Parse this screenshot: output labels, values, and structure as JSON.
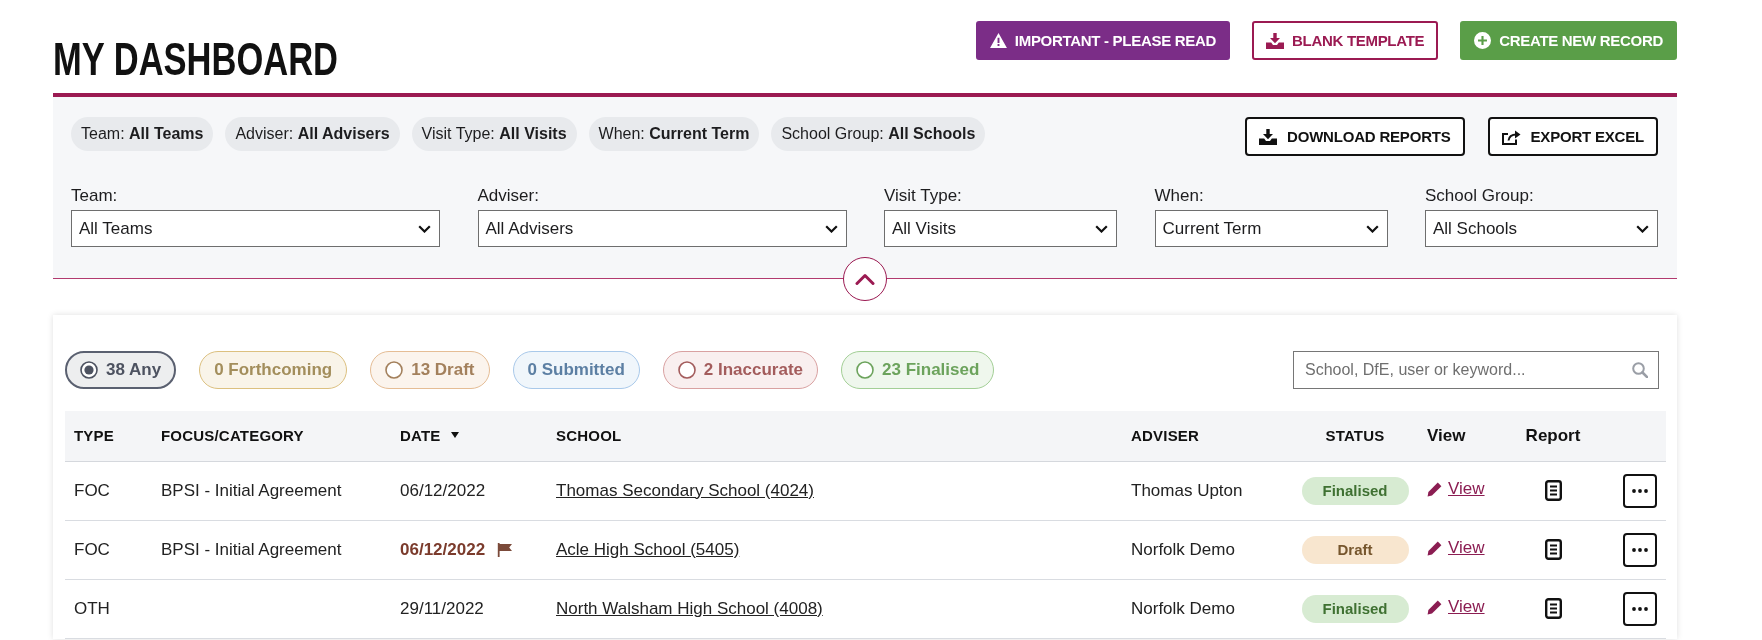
{
  "page": {
    "title": "MY DASHBOARD"
  },
  "header_buttons": [
    {
      "kind": "warning",
      "label": "IMPORTANT - PLEASE READ"
    },
    {
      "kind": "download",
      "label": "BLANK TEMPLATE"
    },
    {
      "kind": "create",
      "label": "CREATE NEW RECORD"
    }
  ],
  "filters": {
    "expanded": true,
    "chips": [
      {
        "label": "Team:",
        "value": "All Teams"
      },
      {
        "label": "Adviser:",
        "value": "All Advisers"
      },
      {
        "label": "Visit Type:",
        "value": "All Visits"
      },
      {
        "label": "When:",
        "value": "Current Term"
      },
      {
        "label": "School Group:",
        "value": "All Schools"
      }
    ],
    "actions": [
      {
        "kind": "download",
        "label": "DOWNLOAD REPORTS"
      },
      {
        "kind": "export",
        "label": "EXPORT EXCEL"
      }
    ],
    "dropdowns": [
      {
        "label": "Team:",
        "value": "All Teams"
      },
      {
        "label": "Adviser:",
        "value": "All Advisers"
      },
      {
        "label": "Visit Type:",
        "value": "All Visits"
      },
      {
        "label": "When:",
        "value": "Current Term"
      },
      {
        "label": "School Group:",
        "value": "All Schools"
      }
    ]
  },
  "status_filters": [
    {
      "label": "38 Any",
      "selected": true,
      "disabled": false,
      "color": "#5a6070"
    },
    {
      "label": "0 Forthcoming",
      "selected": false,
      "disabled": true,
      "color": "#dcc07f"
    },
    {
      "label": "13 Draft",
      "selected": false,
      "disabled": false,
      "color": "#e5bd95"
    },
    {
      "label": "0 Submitted",
      "selected": false,
      "disabled": true,
      "color": "#a9c9ea"
    },
    {
      "label": "2 Inaccurate",
      "selected": false,
      "disabled": false,
      "color": "#d9a1a1"
    },
    {
      "label": "23 Finalised",
      "selected": false,
      "disabled": false,
      "color": "#a3cf96"
    }
  ],
  "search": {
    "placeholder": "School, DfE, user or keyword..."
  },
  "table": {
    "columns": [
      {
        "label": "TYPE",
        "kind": "data",
        "sorted": false
      },
      {
        "label": "FOCUS/CATEGORY",
        "kind": "data",
        "sorted": false
      },
      {
        "label": "DATE",
        "kind": "data",
        "sorted": true
      },
      {
        "label": "SCHOOL",
        "kind": "data",
        "sorted": false
      },
      {
        "label": "ADVISER",
        "kind": "data",
        "sorted": false
      },
      {
        "label": "STATUS",
        "kind": "data",
        "sorted": false
      },
      {
        "label": "View",
        "kind": "action",
        "sorted": false
      },
      {
        "label": "Report",
        "kind": "action",
        "sorted": false
      }
    ],
    "rows": [
      {
        "type": "FOC",
        "focus": "BPSI - Initial Agreement",
        "date": "06/12/2022",
        "flagged": false,
        "school": "Thomas Secondary School (4024)",
        "adviser": "Thomas Upton",
        "status": {
          "label": "Finalised",
          "color": "#d7ebd2"
        },
        "view": "View"
      },
      {
        "type": "FOC",
        "focus": "BPSI - Initial Agreement",
        "date": "06/12/2022",
        "flagged": true,
        "school": "Acle High School (5405)",
        "adviser": "Norfolk Demo",
        "status": {
          "label": "Draft",
          "color": "#f8e6cf"
        },
        "view": "View"
      },
      {
        "type": "OTH",
        "date": "29/11/2022",
        "flagged": false,
        "school": "North Walsham High School (4008)",
        "adviser": "Norfolk Demo",
        "status": {
          "label": "Finalised",
          "color": "#d7ebd2"
        },
        "view": "View"
      }
    ]
  }
}
